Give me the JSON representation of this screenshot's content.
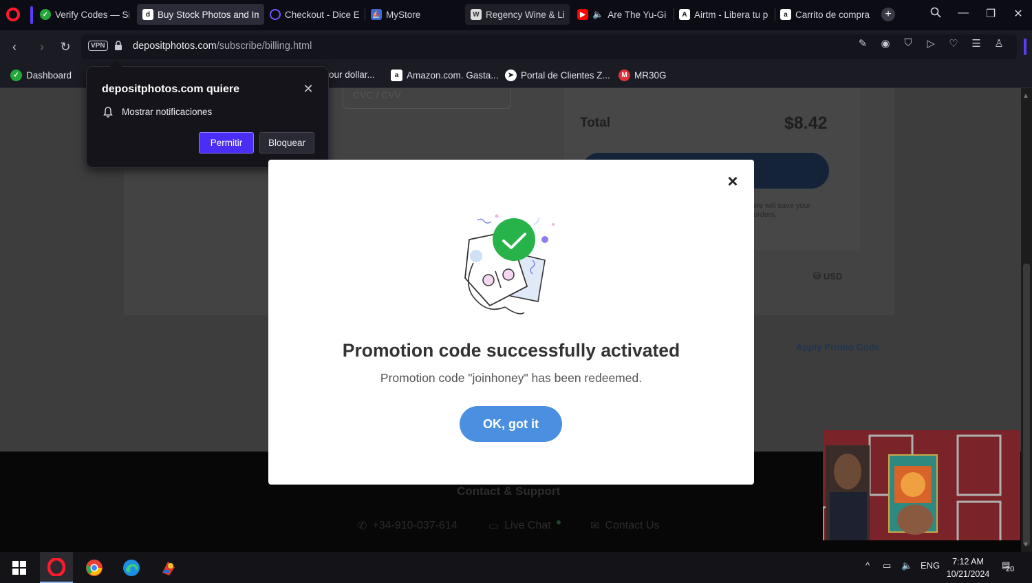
{
  "browser": {
    "tabs": [
      {
        "label": "Verify Codes — Sim",
        "icon": "verify-codes-favicon",
        "color": "#22a838"
      },
      {
        "label": "Buy Stock Photos and Ima",
        "icon": "depositphotos-favicon",
        "color": "#ffffff",
        "active": true
      },
      {
        "label": "Checkout - Dice En",
        "icon": "dice-favicon",
        "color": "#6a5cff"
      },
      {
        "label": "MyStore",
        "icon": "mystore-favicon",
        "color": "#3a6ad0"
      },
      {
        "label": "Regency Wine & Li",
        "icon": "regency-favicon",
        "color": "#dddddd"
      },
      {
        "label": "Are The Yu-Gi-(",
        "icon": "youtube-favicon",
        "color": "#ff0000"
      },
      {
        "label": "Airtm - Libera tu p",
        "icon": "airtm-favicon",
        "color": "#ffffff"
      },
      {
        "label": "Carrito de compras",
        "icon": "amazon-favicon",
        "color": "#ffffff"
      }
    ],
    "address": {
      "vpn_label": "VPN",
      "domain": "depositphotos.com",
      "path": "/subscribe/billing.html"
    },
    "bookmarks": [
      {
        "label": "Dashboard",
        "icon": "dashboard-icon",
        "color": "#22a838"
      },
      {
        "label": "our dollar...",
        "icon": "",
        "color": ""
      },
      {
        "label": "Amazon.com. Gasta...",
        "icon": "amazon-icon",
        "color": "#ffffff"
      },
      {
        "label": "Portal de Clientes Z...",
        "icon": "portal-icon",
        "color": "#ffffff"
      },
      {
        "label": "MR30G",
        "icon": "mr30g-icon",
        "color": "#e0323c"
      }
    ]
  },
  "notification_prompt": {
    "title": "depositphotos.com quiere",
    "permission": "Mostrar notificaciones",
    "allow_label": "Permitir",
    "block_label": "Bloquear"
  },
  "page": {
    "cvv_placeholder": "CVC / CVV",
    "total_label": "Total",
    "total_value": "$8.42",
    "save_note": "we will save your orders.",
    "currency": "USD",
    "promo_link": "Apply Promo Code",
    "footer": {
      "title": "Contact & Support",
      "phone": "+34-910-037-614",
      "live_chat": "Live Chat",
      "contact_us": "Contact Us"
    }
  },
  "modal": {
    "title": "Promotion code successfully activated",
    "message": "Promotion code \"joinhoney\" has been redeemed.",
    "ok_label": "OK, got it",
    "accent": "#4a8fe0",
    "success_color": "#27b34a"
  },
  "taskbar": {
    "apps": [
      "windows-start",
      "opera",
      "chrome",
      "edge",
      "game-app"
    ],
    "language": "ENG",
    "time": "7:12 AM",
    "date": "10/21/2024",
    "notification_count": "20"
  }
}
